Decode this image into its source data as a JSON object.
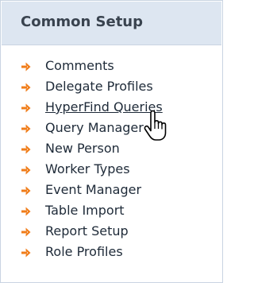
{
  "panel": {
    "title": "Common Setup"
  },
  "links": [
    {
      "label": "Comments",
      "icon": "arrow-right-icon",
      "hovered": false
    },
    {
      "label": "Delegate Profiles",
      "icon": "arrow-right-icon",
      "hovered": false
    },
    {
      "label": "HyperFind Queries",
      "icon": "arrow-right-icon",
      "hovered": true
    },
    {
      "label": "Query Manager",
      "icon": "arrow-right-icon",
      "hovered": false
    },
    {
      "label": "New Person",
      "icon": "arrow-right-icon",
      "hovered": false
    },
    {
      "label": "Worker Types",
      "icon": "arrow-right-icon",
      "hovered": false
    },
    {
      "label": "Event Manager",
      "icon": "arrow-right-icon",
      "hovered": false
    },
    {
      "label": "Table Import",
      "icon": "arrow-right-icon",
      "hovered": false
    },
    {
      "label": "Report Setup",
      "icon": "arrow-right-icon",
      "hovered": false
    },
    {
      "label": "Role Profiles",
      "icon": "arrow-right-icon",
      "hovered": false
    }
  ],
  "colors": {
    "arrow": "#f07d1a",
    "header_bg": "#dde6f1",
    "border": "#c9d4e2"
  },
  "cursor": {
    "icon": "hand-pointer-icon"
  }
}
